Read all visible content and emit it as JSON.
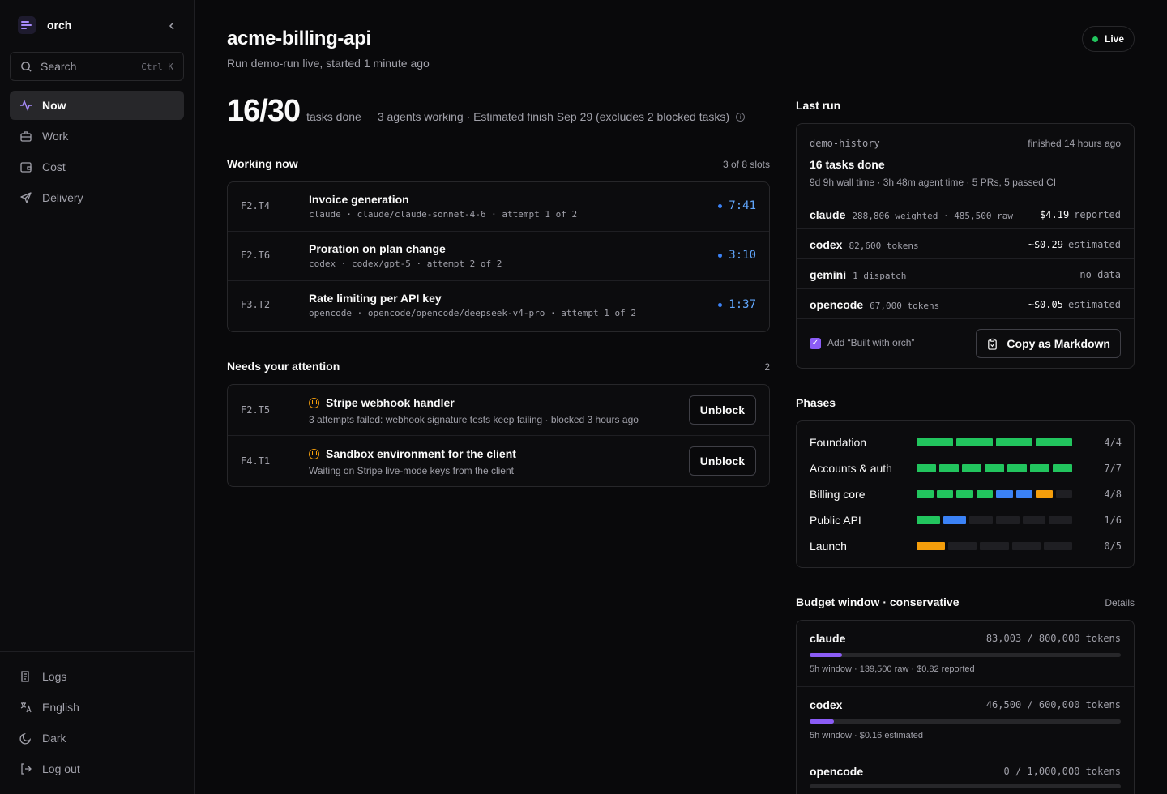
{
  "app": {
    "name": "orch"
  },
  "sidebar": {
    "search": {
      "label": "Search",
      "shortcut": "Ctrl K"
    },
    "nav": [
      {
        "label": "Now",
        "icon": "activity-icon",
        "active": true
      },
      {
        "label": "Work",
        "icon": "briefcase-icon",
        "active": false
      },
      {
        "label": "Cost",
        "icon": "wallet-icon",
        "active": false
      },
      {
        "label": "Delivery",
        "icon": "send-icon",
        "active": false
      }
    ],
    "bottom": [
      {
        "label": "Logs",
        "icon": "logs-icon"
      },
      {
        "label": "English",
        "icon": "translate-icon"
      },
      {
        "label": "Dark",
        "icon": "moon-icon"
      },
      {
        "label": "Log out",
        "icon": "logout-icon"
      }
    ]
  },
  "header": {
    "title": "acme-billing-api",
    "subtitle": "Run demo-run live, started 1 minute ago",
    "status": "Live",
    "status_color": "#22c55e"
  },
  "stats": {
    "done": "16/30",
    "unit": "tasks done",
    "desc": "3 agents working · Estimated finish Sep 29 (excludes 2 blocked tasks)"
  },
  "working": {
    "heading": "Working now",
    "meta": "3 of 8 slots",
    "tasks": [
      {
        "id": "F2.T4",
        "title": "Invoice generation",
        "meta": "claude · claude/claude-sonnet-4-6 · attempt 1 of 2",
        "time": "7:41"
      },
      {
        "id": "F2.T6",
        "title": "Proration on plan change",
        "meta": "codex · codex/gpt-5 · attempt 2 of 2",
        "time": "3:10"
      },
      {
        "id": "F3.T2",
        "title": "Rate limiting per API key",
        "meta": "opencode · opencode/opencode/deepseek-v4-pro · attempt 1 of 2",
        "time": "1:37"
      }
    ]
  },
  "attention": {
    "heading": "Needs your attention",
    "count": "2",
    "items": [
      {
        "id": "F2.T5",
        "title": "Stripe webhook handler",
        "meta": "3 attempts failed: webhook signature tests keep failing · blocked 3 hours ago",
        "action": "Unblock"
      },
      {
        "id": "F4.T1",
        "title": "Sandbox environment for the client",
        "meta": "Waiting on Stripe live-mode keys from the client",
        "action": "Unblock"
      }
    ]
  },
  "last_run": {
    "heading": "Last run",
    "name": "demo-history",
    "finished": "finished 14 hours ago",
    "title": "16 tasks done",
    "sub": "9d 9h wall time · 3h 48m agent time · 5 PRs, 5 passed CI",
    "agents": [
      {
        "name": "claude",
        "tokens": "288,806 weighted · 485,500 raw",
        "cost": "$4.19",
        "note": "reported"
      },
      {
        "name": "codex",
        "tokens": "82,600 tokens",
        "cost": "~$0.29",
        "note": "estimated"
      },
      {
        "name": "gemini",
        "tokens": "1 dispatch",
        "cost": "",
        "note": "no data"
      },
      {
        "name": "opencode",
        "tokens": "67,000 tokens",
        "cost": "~$0.05",
        "note": "estimated"
      }
    ],
    "checkbox_label": "Add “Built with orch”",
    "copy_label": "Copy as Markdown"
  },
  "phases": {
    "heading": "Phases",
    "colors": {
      "done": "#22c55e",
      "active": "#3b82f6",
      "blocked": "#f59e0b",
      "todo": "#1f1f23"
    },
    "items": [
      {
        "name": "Foundation",
        "count": "4/4",
        "segments": [
          "done",
          "done",
          "done",
          "done"
        ]
      },
      {
        "name": "Accounts & auth",
        "count": "7/7",
        "segments": [
          "done",
          "done",
          "done",
          "done",
          "done",
          "done",
          "done"
        ]
      },
      {
        "name": "Billing core",
        "count": "4/8",
        "segments": [
          "done",
          "done",
          "done",
          "done",
          "active",
          "active",
          "blocked",
          "todo"
        ]
      },
      {
        "name": "Public API",
        "count": "1/6",
        "segments": [
          "done",
          "active",
          "todo",
          "todo",
          "todo",
          "todo"
        ]
      },
      {
        "name": "Launch",
        "count": "0/5",
        "segments": [
          "blocked",
          "todo",
          "todo",
          "todo",
          "todo"
        ]
      }
    ]
  },
  "budget": {
    "heading": "Budget window · conservative",
    "details": "Details",
    "items": [
      {
        "name": "claude",
        "tokens": "83,003 / 800,000 tokens",
        "fraction": 0.104,
        "note": "5h window  · 139,500 raw  · $0.82 reported"
      },
      {
        "name": "codex",
        "tokens": "46,500 / 600,000 tokens",
        "fraction": 0.0775,
        "note": "5h window  · $0.16 estimated"
      },
      {
        "name": "opencode",
        "tokens": "0 / 1,000,000 tokens",
        "fraction": 0,
        "note": ""
      }
    ]
  }
}
